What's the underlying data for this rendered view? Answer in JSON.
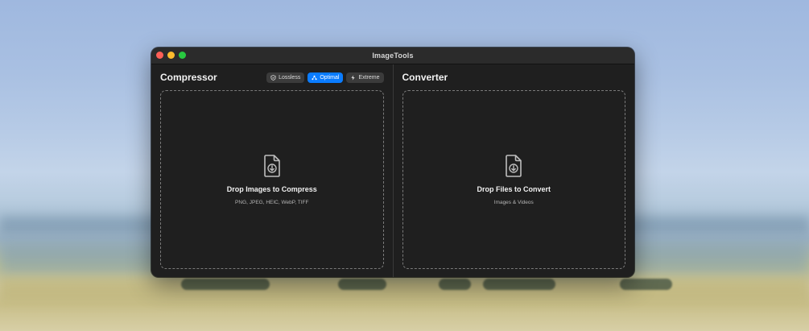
{
  "window": {
    "title": "ImageTools"
  },
  "compressor": {
    "title": "Compressor",
    "modes": [
      {
        "label": "Lossless",
        "icon": "shield-icon",
        "active": false
      },
      {
        "label": "Optimal",
        "icon": "nodes-icon",
        "active": true
      },
      {
        "label": "Extreme",
        "icon": "bolt-icon",
        "active": false
      }
    ],
    "drop_title": "Drop Images to Compress",
    "drop_subtitle": "PNG, JPEG, HEIC, WebP, TIFF",
    "drop_icon": "file-download-icon"
  },
  "converter": {
    "title": "Converter",
    "drop_title": "Drop Files to Convert",
    "drop_subtitle": "Images & Videos",
    "drop_icon": "file-download-icon"
  },
  "colors": {
    "accent": "#0a7cff",
    "window_bg": "#1f1f1f"
  }
}
